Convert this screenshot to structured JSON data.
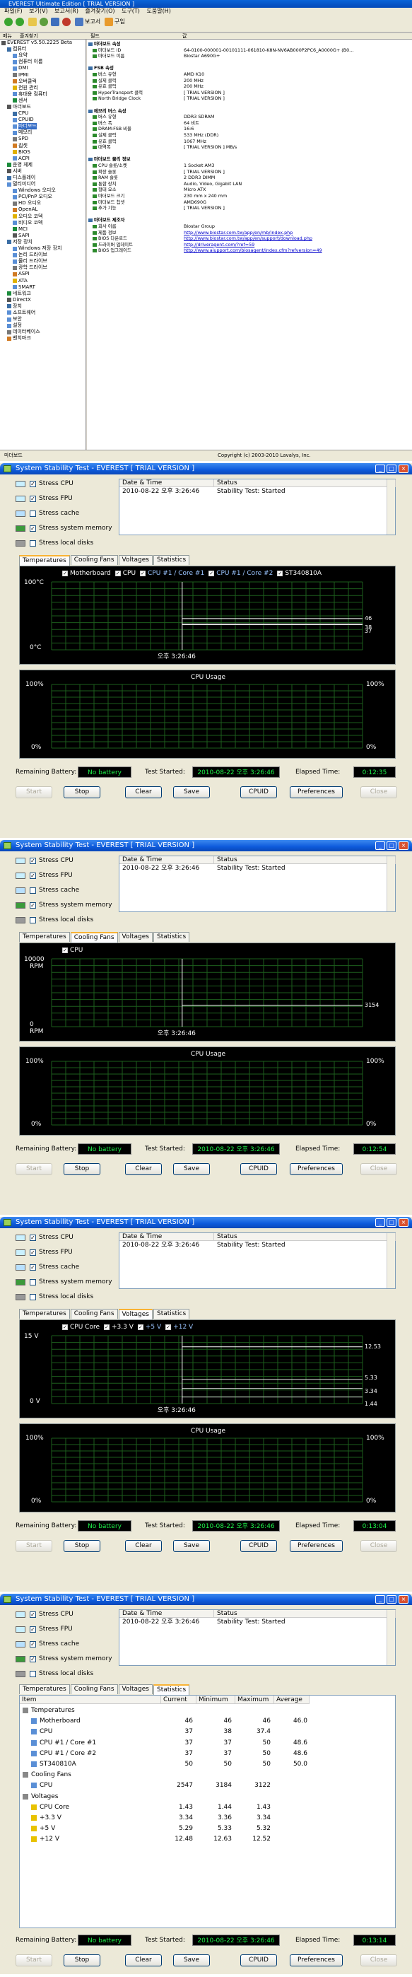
{
  "main": {
    "title": "EVEREST Ultimate Edition  [ TRIAL VERSION ]",
    "menu": [
      "파일(F)",
      "보기(V)",
      "보고서(R)",
      "즐겨찾기(O)",
      "도구(T)",
      "도움말(H)"
    ],
    "toolbar": {
      "report_label": "보고서",
      "buy_label": "구입"
    },
    "headers": {
      "menu_col": "메뉴",
      "favorites_col": "즐겨찾기",
      "field_col": "필드",
      "value_col": "값"
    },
    "tree": [
      "EVEREST v5.50.2225 Beta",
      "컴퓨터",
      "요약",
      "컴퓨터 이름",
      "DMI",
      "IPMI",
      "오버클럭",
      "전원 관리",
      "휴대용 컴퓨터",
      "센서",
      "마더보드",
      "CPU",
      "CPUID",
      "마더보드",
      "메모리",
      "SPD",
      "칩셋",
      "BIOS",
      "ACPI",
      "운영 체제",
      "서버",
      "디스플레이",
      "멀티미디어",
      "Windows 오디오",
      "PCI/PnP 오디오",
      "HD 오디오",
      "OpenAL",
      "오디오 코덱",
      "비디오 코덱",
      "MCI",
      "SAPI",
      "저장 장치",
      "Windows 저장 장치",
      "논리 드라이브",
      "물리 드라이브",
      "광학 드라이브",
      "ASPI",
      "ATA",
      "SMART",
      "네트워크",
      "DirectX",
      "장치",
      "소프트웨어",
      "보안",
      "설정",
      "데이터베이스",
      "벤치마크"
    ],
    "detail": [
      {
        "field": "마더보드 속성",
        "value": "",
        "section": true
      },
      {
        "field": "마더보드 ID",
        "value": "64-0100-000001-00101111-061810-K8N-NV6AB000P2PC6_A0000G+ (B0..."
      },
      {
        "field": "마더보드 이름",
        "value": "Biostar A690G+"
      },
      {
        "field": "",
        "value": ""
      },
      {
        "field": "FSB 속성",
        "value": "",
        "section": true
      },
      {
        "field": "버스 유형",
        "value": "AMD K10"
      },
      {
        "field": "실제 클럭",
        "value": "200 MHz"
      },
      {
        "field": "유효 클럭",
        "value": "200 MHz"
      },
      {
        "field": "HyperTransport 클럭",
        "value": "[ TRIAL VERSION ]"
      },
      {
        "field": "North Bridge Clock",
        "value": "[ TRIAL VERSION ]"
      },
      {
        "field": "",
        "value": ""
      },
      {
        "field": "메모리 버스 속성",
        "value": "",
        "section": true
      },
      {
        "field": "버스 유형",
        "value": "DDR3 SDRAM"
      },
      {
        "field": "버스 폭",
        "value": "64 비트"
      },
      {
        "field": "DRAM:FSB 비율",
        "value": "16:6"
      },
      {
        "field": "실제 클럭",
        "value": "533 MHz (DDR)"
      },
      {
        "field": "유효 클럭",
        "value": "1067 MHz"
      },
      {
        "field": "대역폭",
        "value": "[ TRIAL VERSION ] MB/s"
      },
      {
        "field": "",
        "value": ""
      },
      {
        "field": "마더보드 물리 정보",
        "value": "",
        "section": true
      },
      {
        "field": "CPU 슬롯/소켓",
        "value": "1 Socket AM3"
      },
      {
        "field": "확장 슬롯",
        "value": "[ TRIAL VERSION ]"
      },
      {
        "field": "RAM 슬롯",
        "value": "2 DDR3 DIMM"
      },
      {
        "field": "통합 장치",
        "value": "Audio, Video, Gigabit LAN"
      },
      {
        "field": "형태 요소",
        "value": "Micro ATX"
      },
      {
        "field": "마더보드 크기",
        "value": "230 mm x 240 mm"
      },
      {
        "field": "마더보드 칩셋",
        "value": "AMD690G"
      },
      {
        "field": "추가 기능",
        "value": "[ TRIAL VERSION ]"
      },
      {
        "field": "",
        "value": ""
      },
      {
        "field": "마더보드 제조자",
        "value": "",
        "section": true
      },
      {
        "field": "회사 이름",
        "value": "Biostar Group"
      },
      {
        "field": "제품 정보",
        "value": "http://www.biostar.com.tw/app/en/mb/index.php"
      },
      {
        "field": "BIOS 다운로드",
        "value": "http://www.biostar.com.tw/app/en/support/download.php"
      },
      {
        "field": "드라이버 업데이트",
        "value": "http://driveragent.com/?ref=59"
      },
      {
        "field": "BIOS 업그레이드",
        "value": "http://www.aiupport.com/biosagent/index.cfm?refversion=49"
      }
    ],
    "status_left": "마더보드",
    "status_right": "Copyright (c) 2003-2010 Lavalys, Inc."
  },
  "stability": {
    "title": "System Stability Test - EVEREST  [ TRIAL VERSION ]",
    "checkboxes": [
      "Stress CPU",
      "Stress FPU",
      "Stress cache",
      "Stress system memory",
      "Stress local disks"
    ],
    "log_header_date": "Date & Time",
    "log_header_status": "Status",
    "log_date": "2010-08-22 오후 3:26:46",
    "log_status": "Stability Test: Started",
    "tabs": [
      "Temperatures",
      "Cooling Fans",
      "Voltages",
      "Statistics"
    ],
    "cpu_usage_title": "CPU Usage",
    "usage_top": "100%",
    "usage_bottom": "0%",
    "remaining_battery_label": "Remaining Battery:",
    "no_battery": "No battery",
    "test_started_label": "Test Started:",
    "elapsed_label": "Elapsed Time:",
    "buttons": [
      "Start",
      "Stop",
      "Clear",
      "Save",
      "CPUID",
      "Preferences",
      "Close"
    ],
    "time_marker": "오후 3:26:46"
  },
  "windows": [
    {
      "checked": [
        true,
        true,
        false,
        true,
        false
      ],
      "active_tab": 0,
      "elapsed": "0:12:35",
      "graph": {
        "legend": [
          "Motherboard",
          "CPU",
          "CPU #1 / Core #1",
          "CPU #1 / Core #2",
          "ST340810A"
        ],
        "y_top": "100°C",
        "y_bottom": "0°C",
        "right_values": [
          "46",
          "38",
          "37"
        ],
        "line_values": [
          46,
          38,
          37
        ]
      }
    },
    {
      "checked": [
        true,
        true,
        false,
        true,
        false
      ],
      "active_tab": 1,
      "elapsed": "0:12:54",
      "graph": {
        "legend": [
          "CPU"
        ],
        "y_top": "10000",
        "y_top_unit": "RPM",
        "y_bottom": "0",
        "y_bottom_unit": "RPM",
        "right_values": [
          "3154"
        ],
        "line_values": [
          3154
        ]
      }
    },
    {
      "checked": [
        true,
        true,
        true,
        false,
        false
      ],
      "active_tab": 2,
      "elapsed": "0:13:04",
      "graph": {
        "legend": [
          "CPU Core",
          "+3.3 V",
          "+5 V",
          "+12 V"
        ],
        "y_top": "15 V",
        "y_bottom": "0 V",
        "right_values": [
          "12.53",
          "5.33",
          "3.34",
          "1.44"
        ],
        "line_values": [
          12.53,
          5.33,
          3.34,
          1.44
        ]
      }
    },
    {
      "checked": [
        true,
        true,
        true,
        true,
        false
      ],
      "active_tab": 3,
      "elapsed": "0:13:14"
    }
  ],
  "statistics": {
    "headers": [
      "Item",
      "Current",
      "Minimum",
      "Maximum",
      "Average"
    ],
    "rows": [
      {
        "item": "Temperatures",
        "group": true,
        "icon": "thermometer-icon"
      },
      {
        "item": "Motherboard",
        "cur": "46",
        "min": "46",
        "max": "46",
        "avg": "46.0"
      },
      {
        "item": "CPU",
        "cur": "37",
        "min": "38",
        "max": "37.4",
        "avg": ""
      },
      {
        "item": "CPU #1 / Core #1",
        "cur": "37",
        "min": "37",
        "max": "50",
        "avg": "48.6"
      },
      {
        "item": "CPU #1 / Core #2",
        "cur": "37",
        "min": "37",
        "max": "50",
        "avg": "48.6"
      },
      {
        "item": "ST340810A",
        "cur": "50",
        "min": "50",
        "max": "50",
        "avg": "50.0"
      },
      {
        "item": "Cooling Fans",
        "group": true,
        "icon": "fan-icon"
      },
      {
        "item": "CPU",
        "cur": "2547",
        "min": "3184",
        "max": "3122",
        "avg": ""
      },
      {
        "item": "Voltages",
        "group": true,
        "icon": "voltage-icon"
      },
      {
        "item": "CPU Core",
        "cur": "1.43",
        "min": "1.44",
        "max": "1.43",
        "avg": ""
      },
      {
        "item": "+3.3 V",
        "cur": "3.34",
        "min": "3.36",
        "max": "3.34",
        "avg": ""
      },
      {
        "item": "+5 V",
        "cur": "5.29",
        "min": "5.33",
        "max": "5.32",
        "avg": ""
      },
      {
        "item": "+12 V",
        "cur": "12.48",
        "min": "12.63",
        "max": "12.52",
        "avg": ""
      }
    ]
  },
  "colors": {
    "graph_grid": "#1d5e1d",
    "lcd_text": "#1ef34a",
    "title_blue": "#0d5adb"
  }
}
